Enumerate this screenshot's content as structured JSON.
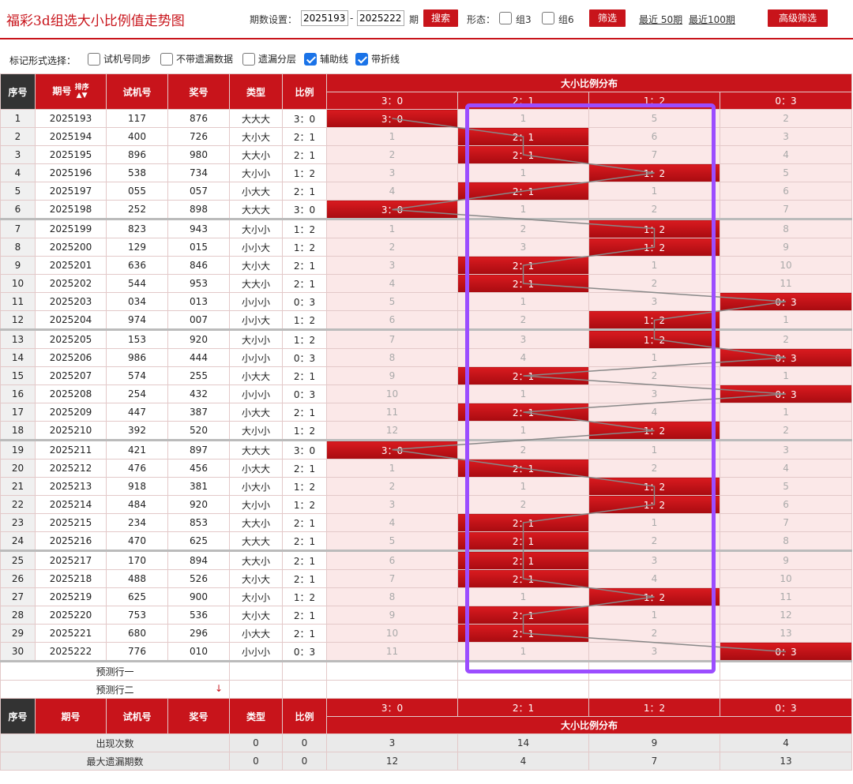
{
  "header": {
    "title": "福彩3d组选大小比例值走势图",
    "period_label": "期数设置：",
    "period_from": "2025193",
    "period_sep": "-",
    "period_to": "2025222",
    "period_suffix": "期",
    "search_label": "搜索",
    "form_label": "形态：",
    "group3_label": "组3",
    "group6_label": "组6",
    "filter_label": "筛选",
    "recent50": "最近 50期",
    "recent100": "最近100期",
    "advanced_label": "高级筛选"
  },
  "mark_bar": {
    "label": "标记形式选择：",
    "options": [
      {
        "label": "试机号同步",
        "checked": false
      },
      {
        "label": "不带遗漏数据",
        "checked": false
      },
      {
        "label": "遗漏分层",
        "checked": false
      },
      {
        "label": "辅助线",
        "checked": true
      },
      {
        "label": "带折线",
        "checked": true
      }
    ]
  },
  "table": {
    "col_seq": "序号",
    "col_issue": "期号",
    "col_sort": "排序",
    "col_test": "试机号",
    "col_prize": "奖号",
    "col_type": "类型",
    "col_ratio": "比例",
    "dist_title": "大小比例分布",
    "dist_cols": [
      "3：0",
      "2：1",
      "1：2",
      "0：3"
    ],
    "rows": [
      {
        "seq": "1",
        "issue": "2025193",
        "test": "117",
        "prize": "876",
        "type": "大大大",
        "ratio": "3：0",
        "hit": 0,
        "cells": [
          "3：0",
          "1",
          "5",
          "2"
        ]
      },
      {
        "seq": "2",
        "issue": "2025194",
        "test": "400",
        "prize": "726",
        "type": "大小大",
        "ratio": "2：1",
        "hit": 1,
        "cells": [
          "1",
          "2：1",
          "6",
          "3"
        ]
      },
      {
        "seq": "3",
        "issue": "2025195",
        "test": "896",
        "prize": "980",
        "type": "大大小",
        "ratio": "2：1",
        "hit": 1,
        "cells": [
          "2",
          "2：1",
          "7",
          "4"
        ]
      },
      {
        "seq": "4",
        "issue": "2025196",
        "test": "538",
        "prize": "734",
        "type": "大小小",
        "ratio": "1：2",
        "hit": 2,
        "cells": [
          "3",
          "1",
          "1：2",
          "5"
        ]
      },
      {
        "seq": "5",
        "issue": "2025197",
        "test": "055",
        "prize": "057",
        "type": "小大大",
        "ratio": "2：1",
        "hit": 1,
        "cells": [
          "4",
          "2：1",
          "1",
          "6"
        ]
      },
      {
        "seq": "6",
        "issue": "2025198",
        "test": "252",
        "prize": "898",
        "type": "大大大",
        "ratio": "3：0",
        "hit": 0,
        "cells": [
          "3：0",
          "1",
          "2",
          "7"
        ]
      },
      {
        "seq": "7",
        "issue": "2025199",
        "test": "823",
        "prize": "943",
        "type": "大小小",
        "ratio": "1：2",
        "hit": 2,
        "cells": [
          "1",
          "2",
          "1：2",
          "8"
        ]
      },
      {
        "seq": "8",
        "issue": "2025200",
        "test": "129",
        "prize": "015",
        "type": "小小大",
        "ratio": "1：2",
        "hit": 2,
        "cells": [
          "2",
          "3",
          "1：2",
          "9"
        ]
      },
      {
        "seq": "9",
        "issue": "2025201",
        "test": "636",
        "prize": "846",
        "type": "大小大",
        "ratio": "2：1",
        "hit": 1,
        "cells": [
          "3",
          "2：1",
          "1",
          "10"
        ]
      },
      {
        "seq": "10",
        "issue": "2025202",
        "test": "544",
        "prize": "953",
        "type": "大大小",
        "ratio": "2：1",
        "hit": 1,
        "cells": [
          "4",
          "2：1",
          "2",
          "11"
        ]
      },
      {
        "seq": "11",
        "issue": "2025203",
        "test": "034",
        "prize": "013",
        "type": "小小小",
        "ratio": "0：3",
        "hit": 3,
        "cells": [
          "5",
          "1",
          "3",
          "0：3"
        ]
      },
      {
        "seq": "12",
        "issue": "2025204",
        "test": "974",
        "prize": "007",
        "type": "小小大",
        "ratio": "1：2",
        "hit": 2,
        "cells": [
          "6",
          "2",
          "1：2",
          "1"
        ]
      },
      {
        "seq": "13",
        "issue": "2025205",
        "test": "153",
        "prize": "920",
        "type": "大小小",
        "ratio": "1：2",
        "hit": 2,
        "cells": [
          "7",
          "3",
          "1：2",
          "2"
        ]
      },
      {
        "seq": "14",
        "issue": "2025206",
        "test": "986",
        "prize": "444",
        "type": "小小小",
        "ratio": "0：3",
        "hit": 3,
        "cells": [
          "8",
          "4",
          "1",
          "0：3"
        ]
      },
      {
        "seq": "15",
        "issue": "2025207",
        "test": "574",
        "prize": "255",
        "type": "小大大",
        "ratio": "2：1",
        "hit": 1,
        "cells": [
          "9",
          "2：1",
          "2",
          "1"
        ]
      },
      {
        "seq": "16",
        "issue": "2025208",
        "test": "254",
        "prize": "432",
        "type": "小小小",
        "ratio": "0：3",
        "hit": 3,
        "cells": [
          "10",
          "1",
          "3",
          "0：3"
        ]
      },
      {
        "seq": "17",
        "issue": "2025209",
        "test": "447",
        "prize": "387",
        "type": "小大大",
        "ratio": "2：1",
        "hit": 1,
        "cells": [
          "11",
          "2：1",
          "4",
          "1"
        ]
      },
      {
        "seq": "18",
        "issue": "2025210",
        "test": "392",
        "prize": "520",
        "type": "大小小",
        "ratio": "1：2",
        "hit": 2,
        "cells": [
          "12",
          "1",
          "1：2",
          "2"
        ]
      },
      {
        "seq": "19",
        "issue": "2025211",
        "test": "421",
        "prize": "897",
        "type": "大大大",
        "ratio": "3：0",
        "hit": 0,
        "cells": [
          "3：0",
          "2",
          "1",
          "3"
        ]
      },
      {
        "seq": "20",
        "issue": "2025212",
        "test": "476",
        "prize": "456",
        "type": "小大大",
        "ratio": "2：1",
        "hit": 1,
        "cells": [
          "1",
          "2：1",
          "2",
          "4"
        ]
      },
      {
        "seq": "21",
        "issue": "2025213",
        "test": "918",
        "prize": "381",
        "type": "小大小",
        "ratio": "1：2",
        "hit": 2,
        "cells": [
          "2",
          "1",
          "1：2",
          "5"
        ]
      },
      {
        "seq": "22",
        "issue": "2025214",
        "test": "484",
        "prize": "920",
        "type": "大小小",
        "ratio": "1：2",
        "hit": 2,
        "cells": [
          "3",
          "2",
          "1：2",
          "6"
        ]
      },
      {
        "seq": "23",
        "issue": "2025215",
        "test": "234",
        "prize": "853",
        "type": "大大小",
        "ratio": "2：1",
        "hit": 1,
        "cells": [
          "4",
          "2：1",
          "1",
          "7"
        ]
      },
      {
        "seq": "24",
        "issue": "2025216",
        "test": "470",
        "prize": "625",
        "type": "大大大",
        "ratio": "2：1",
        "hit": 1,
        "cells": [
          "5",
          "2：1",
          "2",
          "8"
        ]
      },
      {
        "seq": "25",
        "issue": "2025217",
        "test": "170",
        "prize": "894",
        "type": "大大小",
        "ratio": "2：1",
        "hit": 1,
        "cells": [
          "6",
          "2：1",
          "3",
          "9"
        ]
      },
      {
        "seq": "26",
        "issue": "2025218",
        "test": "488",
        "prize": "526",
        "type": "大小大",
        "ratio": "2：1",
        "hit": 1,
        "cells": [
          "7",
          "2：1",
          "4",
          "10"
        ]
      },
      {
        "seq": "27",
        "issue": "2025219",
        "test": "625",
        "prize": "900",
        "type": "大小小",
        "ratio": "1：2",
        "hit": 2,
        "cells": [
          "8",
          "1",
          "1：2",
          "11"
        ]
      },
      {
        "seq": "28",
        "issue": "2025220",
        "test": "753",
        "prize": "536",
        "type": "大小大",
        "ratio": "2：1",
        "hit": 1,
        "cells": [
          "9",
          "2：1",
          "1",
          "12"
        ]
      },
      {
        "seq": "29",
        "issue": "2025221",
        "test": "680",
        "prize": "296",
        "type": "小大大",
        "ratio": "2：1",
        "hit": 1,
        "cells": [
          "10",
          "2：1",
          "2",
          "13"
        ]
      },
      {
        "seq": "30",
        "issue": "2025222",
        "test": "776",
        "prize": "010",
        "type": "小小小",
        "ratio": "0：3",
        "hit": 3,
        "cells": [
          "11",
          "1",
          "3",
          "0：3"
        ]
      }
    ],
    "predict1": "预测行一",
    "predict2": "预测行二",
    "stats": [
      {
        "label": "出现次数",
        "type": "0",
        "ratio": "0",
        "values": [
          "3",
          "14",
          "9",
          "4"
        ]
      },
      {
        "label": "最大遗漏期数",
        "type": "0",
        "ratio": "0",
        "values": [
          "12",
          "4",
          "7",
          "13"
        ]
      }
    ]
  },
  "colors": {
    "accent": "#c8141b",
    "hit_cell": "#c8141b",
    "highlight_box": "#9b4dff",
    "trend_line": "#888888"
  }
}
